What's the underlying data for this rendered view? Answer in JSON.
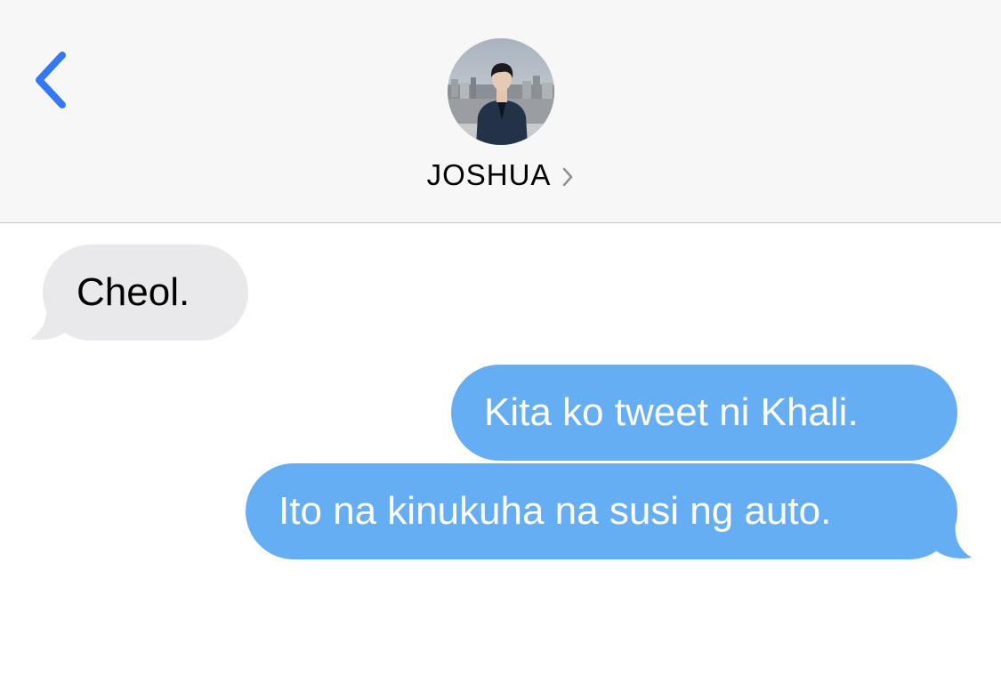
{
  "header": {
    "back_icon": "chevron-left-icon",
    "contact_name": "JOSHUA",
    "contact_chevron_icon": "chevron-right-icon",
    "avatar_icon": "contact-photo"
  },
  "messages": [
    {
      "direction": "received",
      "text": "Cheol."
    },
    {
      "direction": "sent",
      "text": "Kita ko tweet ni Khali."
    },
    {
      "direction": "sent",
      "text": "Ito na kinukuha na susi ng auto."
    }
  ],
  "colors": {
    "header_bg": "#f7f7f7",
    "accent": "#3478f6",
    "received_bubble": "#e9e9eb",
    "sent_bubble": "#66aef3"
  }
}
